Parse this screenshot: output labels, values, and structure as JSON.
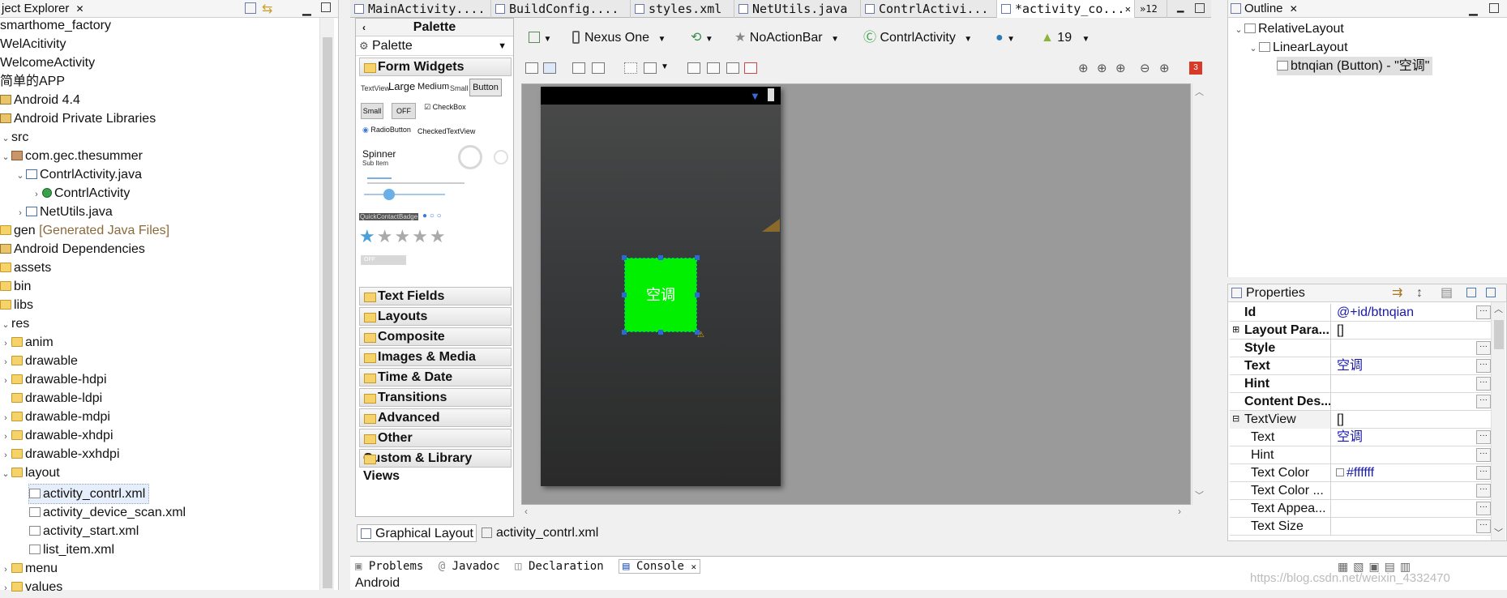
{
  "explorer": {
    "title": "ject Explorer",
    "items": [
      {
        "label": "smarthome_factory",
        "extra": ""
      },
      {
        "label": "WelAcitivity",
        "extra": ""
      },
      {
        "label": "WelcomeActivity",
        "extra": ""
      },
      {
        "label": "简单的APP",
        "extra": ""
      },
      {
        "label": "Android 4.4",
        "extra": ""
      },
      {
        "label": "Android Private Libraries",
        "extra": ""
      },
      {
        "label": "src",
        "extra": ""
      },
      {
        "label": "com.gec.thesummer",
        "extra": ""
      },
      {
        "label": "ContrlActivity.java",
        "extra": ""
      },
      {
        "label": "ContrlActivity",
        "extra": ""
      },
      {
        "label": "NetUtils.java",
        "extra": ""
      },
      {
        "label": "gen",
        "extra": "[Generated Java Files]"
      },
      {
        "label": "Android Dependencies",
        "extra": ""
      },
      {
        "label": "assets",
        "extra": ""
      },
      {
        "label": "bin",
        "extra": ""
      },
      {
        "label": "libs",
        "extra": ""
      },
      {
        "label": "res",
        "extra": ""
      },
      {
        "label": "anim",
        "extra": ""
      },
      {
        "label": "drawable",
        "extra": ""
      },
      {
        "label": "drawable-hdpi",
        "extra": ""
      },
      {
        "label": "drawable-ldpi",
        "extra": ""
      },
      {
        "label": "drawable-mdpi",
        "extra": ""
      },
      {
        "label": "drawable-xhdpi",
        "extra": ""
      },
      {
        "label": "drawable-xxhdpi",
        "extra": ""
      },
      {
        "label": "layout",
        "extra": ""
      },
      {
        "label": "activity_contrl.xml",
        "extra": ""
      },
      {
        "label": "activity_device_scan.xml",
        "extra": ""
      },
      {
        "label": "activity_start.xml",
        "extra": ""
      },
      {
        "label": "list_item.xml",
        "extra": ""
      },
      {
        "label": "menu",
        "extra": ""
      },
      {
        "label": "values",
        "extra": ""
      }
    ]
  },
  "editor_tabs": [
    "MainActivity....",
    "BuildConfig....",
    "styles.xml",
    "NetUtils.java",
    "ContrlActivi...",
    "*activity_co...",
    "»12"
  ],
  "palette": {
    "title": "Palette",
    "selector": "Palette",
    "sections": [
      "Form Widgets",
      "Text Fields",
      "Layouts",
      "Composite",
      "Images & Media",
      "Time & Date",
      "Transitions",
      "Advanced",
      "Other",
      "Custom & Library Views"
    ],
    "widgets": {
      "textview": "TextView",
      "large": "Large",
      "medium": "Medium",
      "small": "Small",
      "button": "Button",
      "small_btn": "Small",
      "off": "OFF",
      "checkbox": "CheckBox",
      "radio": "RadioButton",
      "checked_tv": "CheckedTextView",
      "spinner": "Spinner",
      "sub_item": "Sub Item",
      "quick_contact": "QuickContactBadge",
      "switch_off": "OFF"
    }
  },
  "toolbar": {
    "device": "Nexus One",
    "theme": "NoActionBar",
    "activity": "ContrlActivity",
    "api": "19",
    "error_count": "3"
  },
  "canvas": {
    "button_text": "空调"
  },
  "editor_bottom_tabs": [
    "Graphical Layout",
    "activity_contrl.xml"
  ],
  "outline": {
    "title": "Outline",
    "nodes": [
      "RelativeLayout",
      "LinearLayout",
      "btnqian (Button) - \"空调\""
    ]
  },
  "properties": {
    "title": "Properties",
    "rows": [
      {
        "key": "Id",
        "value": "@+id/btnqian",
        "bold": true
      },
      {
        "key": "Layout Para...",
        "value": "[]",
        "bold": true
      },
      {
        "key": "Style",
        "value": "",
        "bold": true
      },
      {
        "key": "Text",
        "value": "空调",
        "bold": true
      },
      {
        "key": "Hint",
        "value": "",
        "bold": true
      },
      {
        "key": "Content Des...",
        "value": "",
        "bold": true
      },
      {
        "key": "TextView",
        "value": "[]",
        "bold": false
      },
      {
        "key": "Text",
        "value": "空调",
        "bold": false
      },
      {
        "key": "Hint",
        "value": "",
        "bold": false
      },
      {
        "key": "Text Color",
        "value": "#ffffff",
        "bold": false
      },
      {
        "key": "Text Color ...",
        "value": "",
        "bold": false
      },
      {
        "key": "Text Appea...",
        "value": "",
        "bold": false
      },
      {
        "key": "Text Size",
        "value": "",
        "bold": false
      }
    ]
  },
  "console": {
    "tabs": [
      "Problems",
      "Javadoc",
      "Declaration",
      "Console"
    ],
    "content": "Android"
  },
  "watermark": "https://blog.csdn.net/weixin_4332470"
}
